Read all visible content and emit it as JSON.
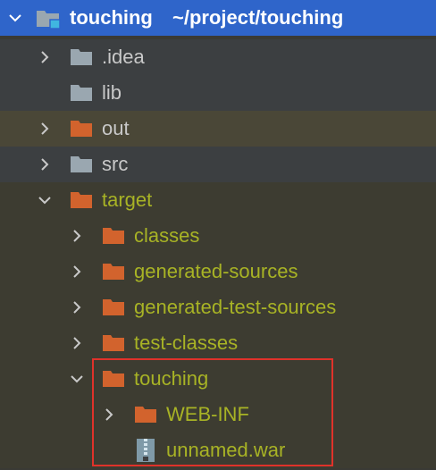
{
  "project": {
    "name": "touching",
    "path": "~/project/touching"
  },
  "items": {
    "idea": {
      "label": ".idea"
    },
    "lib": {
      "label": "lib"
    },
    "out": {
      "label": "out"
    },
    "src": {
      "label": "src"
    },
    "target": {
      "label": "target"
    },
    "classes": {
      "label": "classes"
    },
    "generated_sources": {
      "label": "generated-sources"
    },
    "generated_test_sources": {
      "label": "generated-test-sources"
    },
    "test_classes": {
      "label": "test-classes"
    },
    "touching": {
      "label": "touching"
    },
    "web_inf": {
      "label": "WEB-INF"
    },
    "unnamed_war": {
      "label": "unnamed.war"
    }
  },
  "colors": {
    "header_bg": "#2f65ca",
    "folder_grey": "#9aa7b0",
    "folder_orange": "#d2632d",
    "excluded_text": "#a8b325",
    "highlight_border": "#e0322a"
  }
}
